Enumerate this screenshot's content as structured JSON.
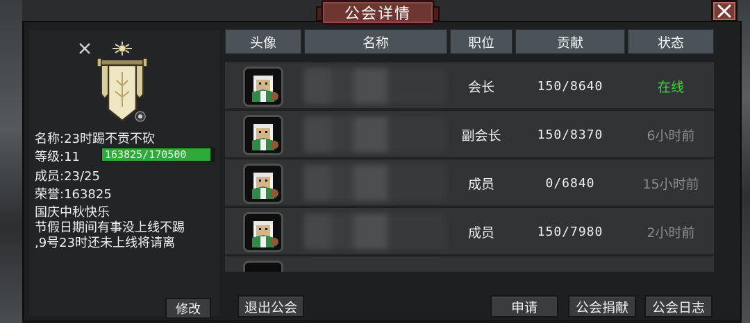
{
  "window": {
    "title": "公会详情"
  },
  "guild": {
    "name_label": "名称:",
    "name_value": "23时踢不贡不砍",
    "level_label": "等级:",
    "level_value": "11",
    "xp_text": "163825/170500",
    "xp_progress": 0.961,
    "members_label": "成员:",
    "members_value": "23/25",
    "honor_label": "荣誉:",
    "honor_value": "163825",
    "notice_lines": [
      "国庆中秋快乐",
      "节假日期间有事没上线不踢",
      ",9号23时还未上线将请离"
    ],
    "modify_label": "修改"
  },
  "table": {
    "headers": [
      "头像",
      "名称",
      "职位",
      "贡献",
      "状态"
    ],
    "rows": [
      {
        "role": "会长",
        "contribution": "150/8640",
        "status": "在线",
        "online": true
      },
      {
        "role": "副会长",
        "contribution": "150/8370",
        "status": "6小时前",
        "online": false
      },
      {
        "role": "成员",
        "contribution": "0/6840",
        "status": "15小时前",
        "online": false
      },
      {
        "role": "成员",
        "contribution": "150/7980",
        "status": "2小时前",
        "online": false
      }
    ]
  },
  "buttons": {
    "leave": "退出公会",
    "apply": "申请",
    "donate": "公会捐献",
    "log": "公会日志"
  },
  "colors": {
    "online": "#3fd13c",
    "offline": "#8c8c8c",
    "xp_fill": "#2faa3a",
    "title_plaque": "#6e3531"
  }
}
